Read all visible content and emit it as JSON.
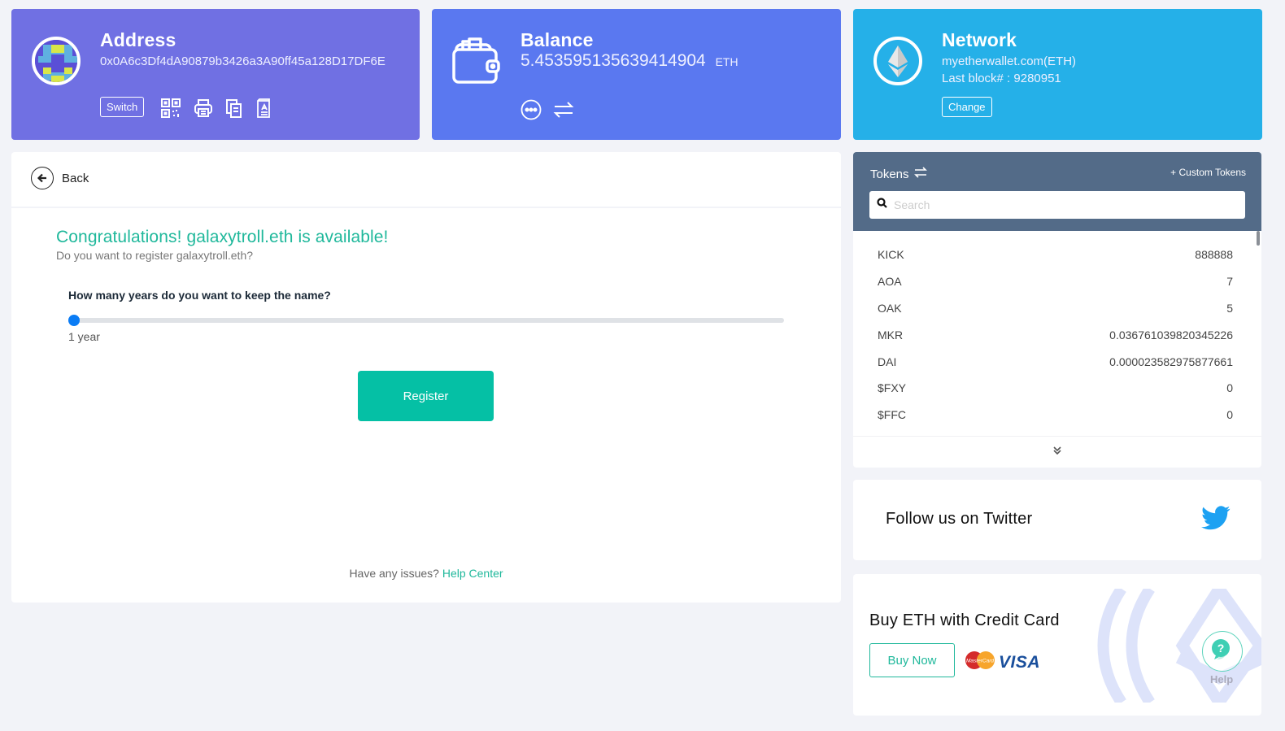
{
  "address_card": {
    "title": "Address",
    "address": "0x0A6c3Df4dA90879b3426a3A90ff45a128D17DF6E",
    "switch_label": "Switch",
    "actions": [
      "qr-code",
      "print",
      "copy",
      "keystore"
    ],
    "color": "#7070e3"
  },
  "balance_card": {
    "title": "Balance",
    "amount": "5.453595135639414904",
    "unit": "ETH",
    "actions": [
      "more",
      "swap"
    ],
    "color": "#5a78f0"
  },
  "network_card": {
    "title": "Network",
    "network": "myetherwallet.com(ETH)",
    "last_block": "Last block# : 9280951",
    "change_label": "Change",
    "color": "#25b0e8"
  },
  "main": {
    "back_label": "Back",
    "congrats": "Congratulations! galaxytroll.eth is available!",
    "register_question": "Do you want to register galaxytroll.eth?",
    "years_question": "How many years do you want to keep the name?",
    "slider": {
      "value": 1,
      "min": 1,
      "fraction": 0.0
    },
    "slider_value_label": "1 year",
    "register_label": "Register",
    "help_text": "Have any issues?",
    "help_link": "Help Center",
    "accent": "#05c0a5"
  },
  "tokens": {
    "title": "Tokens",
    "custom_label": "+ Custom Tokens",
    "search_placeholder": "Search",
    "search_value": "",
    "items": [
      {
        "symbol": "KICK",
        "balance": "888888"
      },
      {
        "symbol": "AOA",
        "balance": "7"
      },
      {
        "symbol": "OAK",
        "balance": "5"
      },
      {
        "symbol": "MKR",
        "balance": "0.036761039820345226"
      },
      {
        "symbol": "DAI",
        "balance": "0.000023582975877661"
      },
      {
        "symbol": "$FXY",
        "balance": "0"
      },
      {
        "symbol": "$FFC",
        "balance": "0"
      }
    ],
    "header_color": "#536b88"
  },
  "twitter": {
    "label": "Follow us on Twitter"
  },
  "buy": {
    "title": "Buy ETH with Credit Card",
    "button": "Buy Now",
    "mastercard_label": "MasterCard",
    "visa_label": "VISA"
  },
  "help_widget": {
    "label": "Help"
  }
}
